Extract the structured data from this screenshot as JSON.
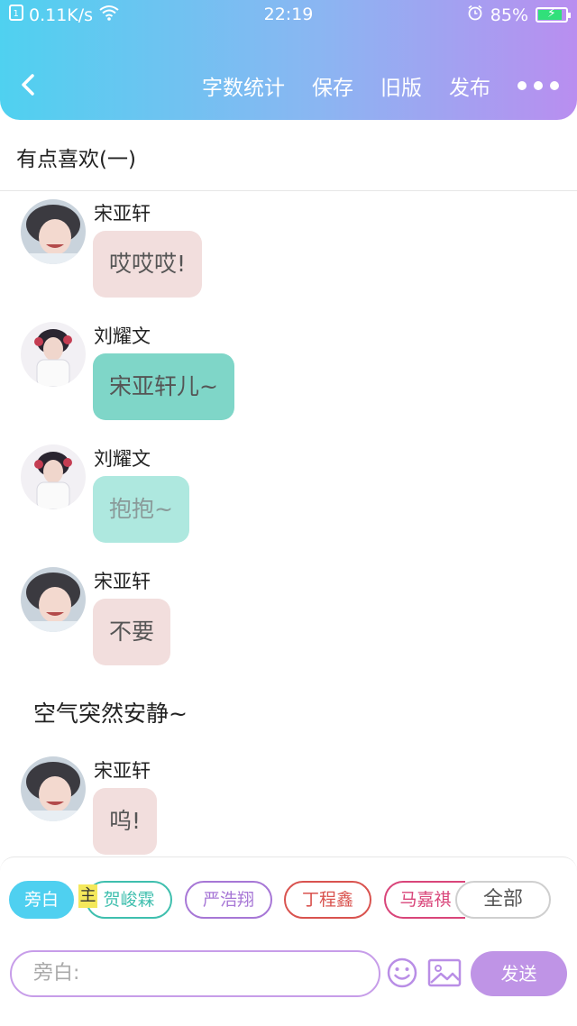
{
  "status": {
    "speed": "0.11K/s",
    "time": "22:19",
    "battery": "85%",
    "battery_level": 0.85
  },
  "nav": {
    "back_icon": "chevron-left-icon",
    "actions": [
      "字数统计",
      "保存",
      "旧版",
      "发布"
    ],
    "more_icon": "more-dots-icon"
  },
  "title": "有点喜欢(一)",
  "messages": [
    {
      "type": "bubble",
      "name": "宋亚轩",
      "text": "哎哎哎!",
      "style": "pink"
    },
    {
      "type": "bubble",
      "name": "刘耀文",
      "text": "宋亚轩儿~",
      "style": "teal"
    },
    {
      "type": "bubble",
      "name": "刘耀文",
      "text": "抱抱~",
      "style": "lteal"
    },
    {
      "type": "bubble",
      "name": "宋亚轩",
      "text": "不要",
      "style": "pink"
    },
    {
      "type": "narration",
      "text": "空气突然安静~"
    },
    {
      "type": "bubble",
      "name": "宋亚轩",
      "text": "呜!",
      "style": "pink"
    }
  ],
  "chips": [
    {
      "label": "旁白",
      "active": true,
      "color": "#4fd0f0"
    },
    {
      "label": "贺峻霖",
      "active": false,
      "color": "#3fbfae"
    },
    {
      "label": "严浩翔",
      "active": false,
      "color": "#a777d6"
    },
    {
      "label": "丁程鑫",
      "active": false,
      "color": "#d9534f"
    },
    {
      "label": "马嘉祺",
      "active": false,
      "color": "#d9457a"
    },
    {
      "label": "全部",
      "active": false,
      "color": "#cfcfcf"
    }
  ],
  "highlight_char": "主",
  "input": {
    "placeholder": "旁白:"
  },
  "emoji_icon": "smiley-icon",
  "image_icon": "image-icon",
  "send_label": "发送",
  "accent_colors": {
    "header_start": "#4fd1f0",
    "header_end": "#b98ef0",
    "send": "#bf94e6"
  }
}
